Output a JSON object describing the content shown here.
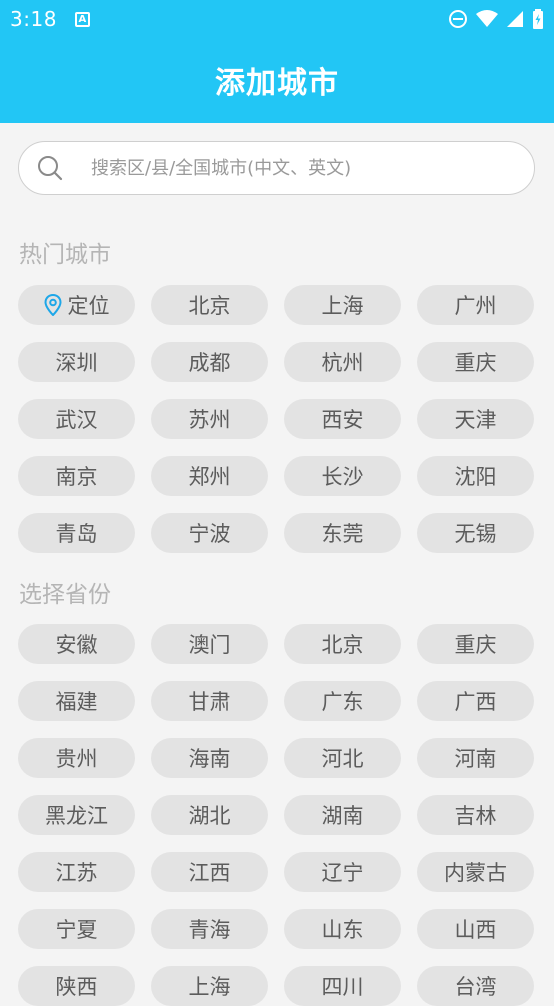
{
  "status_bar": {
    "time": "3:18",
    "notification_icon": "A"
  },
  "header": {
    "title": "添加城市"
  },
  "search": {
    "placeholder": "搜索区/县/全国城市(中文、英文)"
  },
  "hot_cities": {
    "title": "热门城市",
    "items": [
      {
        "label": "定位",
        "icon": "location-pin"
      },
      {
        "label": "北京"
      },
      {
        "label": "上海"
      },
      {
        "label": "广州"
      },
      {
        "label": "深圳"
      },
      {
        "label": "成都"
      },
      {
        "label": "杭州"
      },
      {
        "label": "重庆"
      },
      {
        "label": "武汉"
      },
      {
        "label": "苏州"
      },
      {
        "label": "西安"
      },
      {
        "label": "天津"
      },
      {
        "label": "南京"
      },
      {
        "label": "郑州"
      },
      {
        "label": "长沙"
      },
      {
        "label": "沈阳"
      },
      {
        "label": "青岛"
      },
      {
        "label": "宁波"
      },
      {
        "label": "东莞"
      },
      {
        "label": "无锡"
      }
    ]
  },
  "provinces": {
    "title": "选择省份",
    "items": [
      {
        "label": "安徽"
      },
      {
        "label": "澳门"
      },
      {
        "label": "北京"
      },
      {
        "label": "重庆"
      },
      {
        "label": "福建"
      },
      {
        "label": "甘肃"
      },
      {
        "label": "广东"
      },
      {
        "label": "广西"
      },
      {
        "label": "贵州"
      },
      {
        "label": "海南"
      },
      {
        "label": "河北"
      },
      {
        "label": "河南"
      },
      {
        "label": "黑龙江"
      },
      {
        "label": "湖北"
      },
      {
        "label": "湖南"
      },
      {
        "label": "吉林"
      },
      {
        "label": "江苏"
      },
      {
        "label": "江西"
      },
      {
        "label": "辽宁"
      },
      {
        "label": "内蒙古"
      },
      {
        "label": "宁夏"
      },
      {
        "label": "青海"
      },
      {
        "label": "山东"
      },
      {
        "label": "山西"
      },
      {
        "label": "陕西"
      },
      {
        "label": "上海"
      },
      {
        "label": "四川"
      },
      {
        "label": "台湾"
      }
    ]
  }
}
